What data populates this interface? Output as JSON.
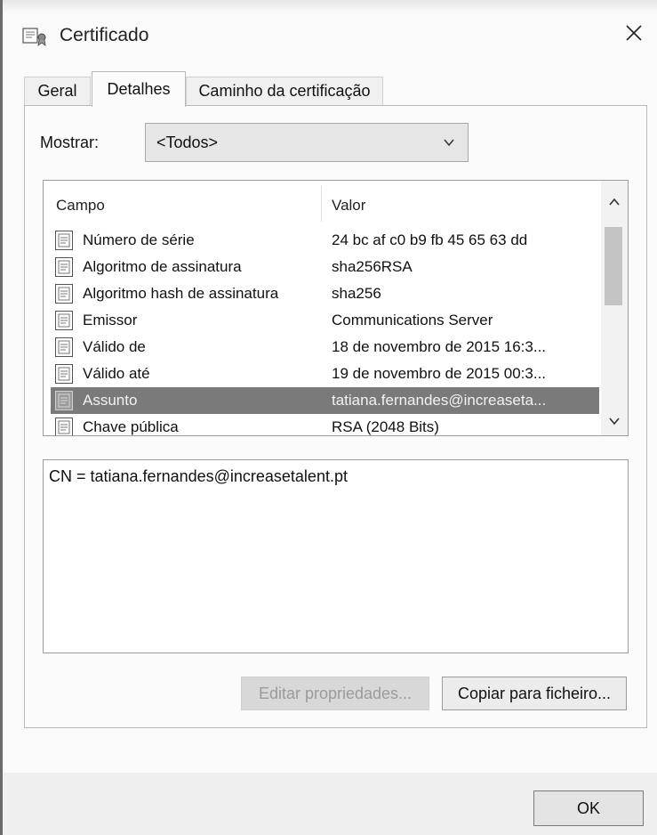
{
  "window": {
    "title": "Certificado",
    "close_glyph": "✕"
  },
  "tabs": [
    {
      "label": "Geral",
      "active": false
    },
    {
      "label": "Detalhes",
      "active": true
    },
    {
      "label": "Caminho da certificação",
      "active": false
    }
  ],
  "show": {
    "label": "Mostrar:",
    "selected": "<Todos>"
  },
  "list": {
    "headers": {
      "field": "Campo",
      "value": "Valor"
    },
    "rows": [
      {
        "field": "Número de série",
        "value": "24 bc af c0 b9 fb 45 65 63 dd"
      },
      {
        "field": "Algoritmo de assinatura",
        "value": "sha256RSA"
      },
      {
        "field": "Algoritmo hash de assinatura",
        "value": "sha256"
      },
      {
        "field": "Emissor",
        "value": "Communications Server"
      },
      {
        "field": "Válido de",
        "value": "18 de novembro de 2015 16:3..."
      },
      {
        "field": "Válido até",
        "value": "19 de novembro de 2015 00:3..."
      },
      {
        "field": "Assunto",
        "value": "tatiana.fernandes@increaseta..."
      },
      {
        "field": "Chave pública",
        "value": "RSA (2048 Bits)"
      }
    ],
    "selected_index": 6
  },
  "detail": {
    "text": "CN = tatiana.fernandes@increasetalent.pt"
  },
  "buttons": {
    "edit_label": "Editar propriedades...",
    "copy_label": "Copiar para ficheiro...",
    "ok_label": "OK"
  },
  "colors": {
    "selected_row": "#7a7a7a",
    "disabled_text": "#9b9b9b"
  }
}
